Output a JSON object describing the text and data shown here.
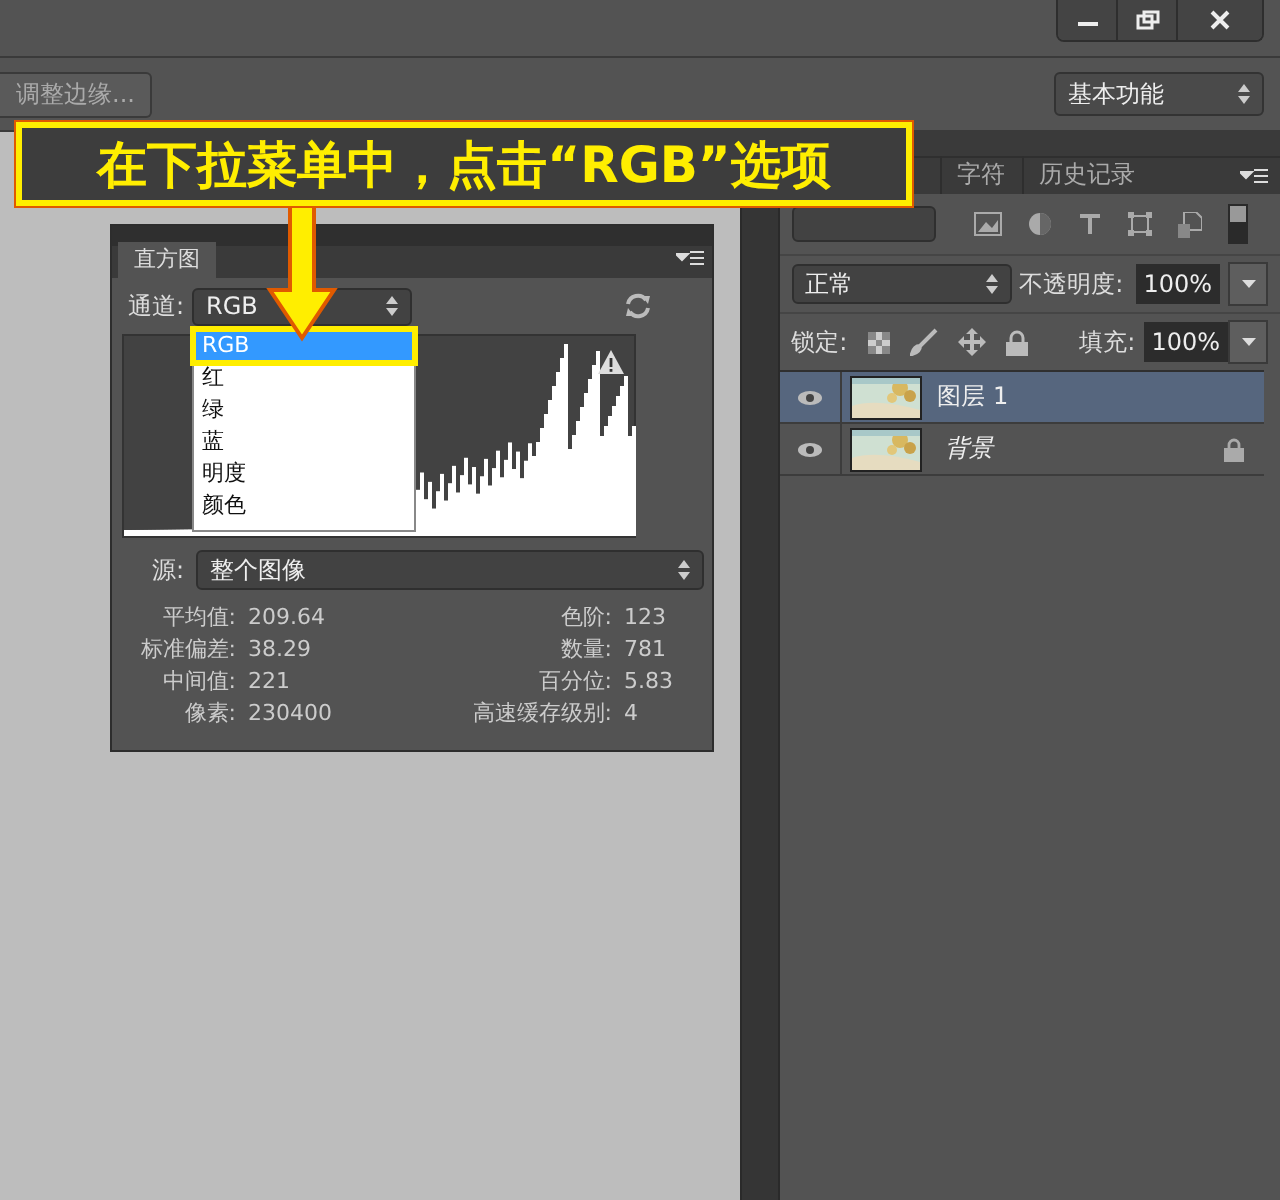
{
  "options_bar": {
    "refine_edge_button": "调整边缘...",
    "workspace": "基本功能"
  },
  "annotation": {
    "text": "在下拉菜单中，点击“RGB”选项"
  },
  "histogram_panel": {
    "title": "直方图",
    "channel_label": "通道:",
    "channel_value": "RGB",
    "channel_options": [
      {
        "label": "RGB",
        "selected": true
      },
      {
        "label": "红",
        "selected": false
      },
      {
        "label": "绿",
        "selected": false
      },
      {
        "label": "蓝",
        "selected": false
      },
      {
        "label": "明度",
        "selected": false
      },
      {
        "label": "颜色",
        "selected": false
      }
    ],
    "source_label": "源:",
    "source_value": "整个图像",
    "stats_left": [
      {
        "label": "平均值:",
        "value": "209.64"
      },
      {
        "label": "标准偏差:",
        "value": "38.29"
      },
      {
        "label": "中间值:",
        "value": "221"
      },
      {
        "label": "像素:",
        "value": "230400"
      }
    ],
    "stats_right": [
      {
        "label": "色阶:",
        "value": "123"
      },
      {
        "label": "数量:",
        "value": "781"
      },
      {
        "label": "百分位:",
        "value": "5.83"
      },
      {
        "label": "高速缓存级别:",
        "value": "4"
      }
    ]
  },
  "layers_panel": {
    "tabs": [
      {
        "label": "字符",
        "selected": false
      },
      {
        "label": "历史记录",
        "selected": false
      }
    ],
    "blend_mode": "正常",
    "opacity_label": "不透明度:",
    "opacity": "100%",
    "lock_label": "锁定:",
    "fill_label": "填充:",
    "fill": "100%",
    "layers": [
      {
        "name": "图层 1",
        "kind": "layer",
        "selected": true
      },
      {
        "name": "背景",
        "kind": "background",
        "selected": false
      }
    ]
  }
}
